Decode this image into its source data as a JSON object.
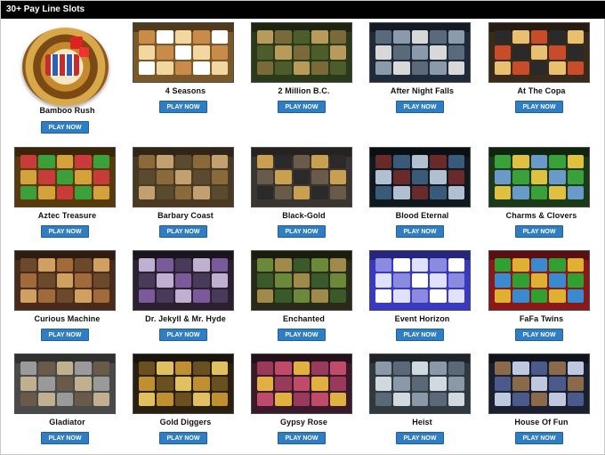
{
  "header": {
    "title": "30+ Pay Line Slots"
  },
  "play_label": "PLAY NOW",
  "games": [
    {
      "name": "Bamboo Rush",
      "bg": "#ffffff",
      "sym": [
        "#2b5fbf",
        "#c92a2a",
        "#ffffff"
      ]
    },
    {
      "name": "4 Seasons",
      "bg": "#7a5a2a",
      "sym": [
        "#f2d7a0",
        "#c98b4a",
        "#ffffff"
      ]
    },
    {
      "name": "2 Million B.C.",
      "bg": "#2a3a1a",
      "sym": [
        "#7a6a3a",
        "#4c5c2a",
        "#b89a5a"
      ]
    },
    {
      "name": "After Night Falls",
      "bg": "#1f2a3a",
      "sym": [
        "#5a6a7a",
        "#8a9aaa",
        "#d8d8d8"
      ]
    },
    {
      "name": "At The Copa",
      "bg": "#3a2a1a",
      "sym": [
        "#c84b2a",
        "#2a2a2a",
        "#e8c070"
      ]
    },
    {
      "name": "Aztec Treasure",
      "bg": "#5a3a0a",
      "sym": [
        "#3aa03a",
        "#d4a23a",
        "#c93a3a"
      ]
    },
    {
      "name": "Barbary Coast",
      "bg": "#4a3a22",
      "sym": [
        "#8a6a3a",
        "#c2a070",
        "#5a4a30"
      ]
    },
    {
      "name": "Black-Gold",
      "bg": "#3a3530",
      "sym": [
        "#6a5a4a",
        "#c8a050",
        "#2a2a2a"
      ]
    },
    {
      "name": "Blood Eternal",
      "bg": "#101820",
      "sym": [
        "#3a5a7a",
        "#b0c0d0",
        "#6a2a2a"
      ]
    },
    {
      "name": "Charms & Clovers",
      "bg": "#1a3a1a",
      "sym": [
        "#3aa03a",
        "#e0c040",
        "#6a9aca"
      ]
    },
    {
      "name": "Curious Machine",
      "bg": "#4a2a1a",
      "sym": [
        "#a06a3a",
        "#6a4a2a",
        "#d0a060"
      ]
    },
    {
      "name": "Dr. Jekyll & Mr. Hyde",
      "bg": "#2a2030",
      "sym": [
        "#7a5a9a",
        "#4a3a5a",
        "#c0b0d0"
      ]
    },
    {
      "name": "Enchanted",
      "bg": "#2a2a1a",
      "sym": [
        "#6a8a3a",
        "#a08a4a",
        "#3a5a2a"
      ]
    },
    {
      "name": "Event Horizon",
      "bg": "#3a3ac0",
      "sym": [
        "#e0e0ff",
        "#8a8ae0",
        "#ffffff"
      ]
    },
    {
      "name": "FaFa Twins",
      "bg": "#8a1a1a",
      "sym": [
        "#e0b030",
        "#3a8ad0",
        "#30a030"
      ]
    },
    {
      "name": "Gladiator",
      "bg": "#4a4a4a",
      "sym": [
        "#9a9a9a",
        "#6a5a4a",
        "#c0b090"
      ]
    },
    {
      "name": "Gold Diggers",
      "bg": "#2a2010",
      "sym": [
        "#c09030",
        "#6a5020",
        "#e0c060"
      ]
    },
    {
      "name": "Gypsy Rose",
      "bg": "#3a1a2a",
      "sym": [
        "#c04a6a",
        "#e0b040",
        "#9a3a5a"
      ]
    },
    {
      "name": "Heist",
      "bg": "#303840",
      "sym": [
        "#8a98a8",
        "#5a6878",
        "#d0d8e0"
      ]
    },
    {
      "name": "House Of Fun",
      "bg": "#1a2030",
      "sym": [
        "#4a5a8a",
        "#8a6a4a",
        "#c0c8e0"
      ]
    }
  ]
}
